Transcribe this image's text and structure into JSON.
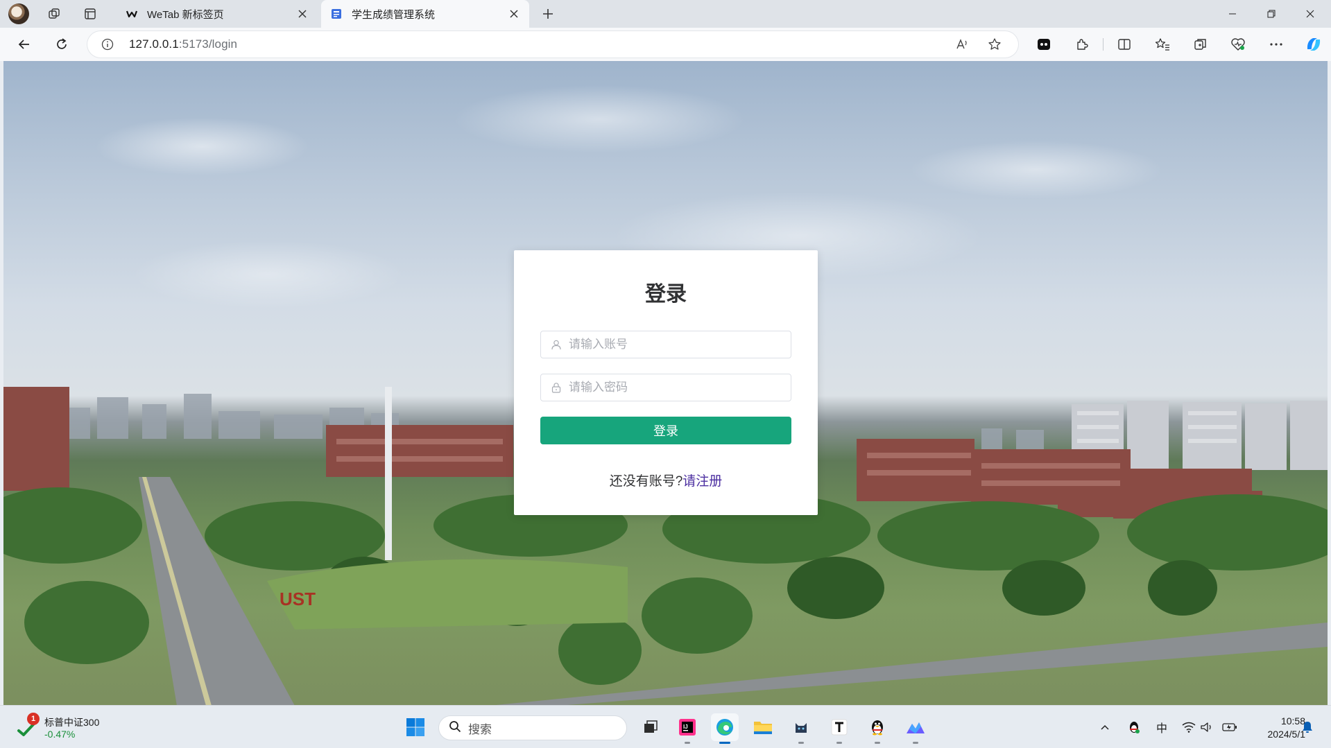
{
  "browser": {
    "tabs": [
      {
        "title": "WeTab 新标签页",
        "active": false,
        "favicon": "wetab-logo-icon"
      },
      {
        "title": "学生成绩管理系统",
        "active": true,
        "favicon": "document-icon"
      }
    ],
    "address": {
      "host": "127.0.0.1",
      "port_path": ":5173/login"
    }
  },
  "login": {
    "title": "登录",
    "account_placeholder": "请输入账号",
    "password_placeholder": "请输入密码",
    "submit_label": "登录",
    "register_prompt": "还没有账号?",
    "register_link": "请注册"
  },
  "taskbar": {
    "stock": {
      "badge": "1",
      "name": "标普中证300",
      "change": "-0.47%"
    },
    "search_label": "搜索",
    "ime_label": "中",
    "time": "10:58",
    "date": "2024/5/1"
  },
  "colors": {
    "accent_button": "#17a57c",
    "link": "#4b2ea0",
    "taskbar_bg": "#e6ebf1"
  }
}
